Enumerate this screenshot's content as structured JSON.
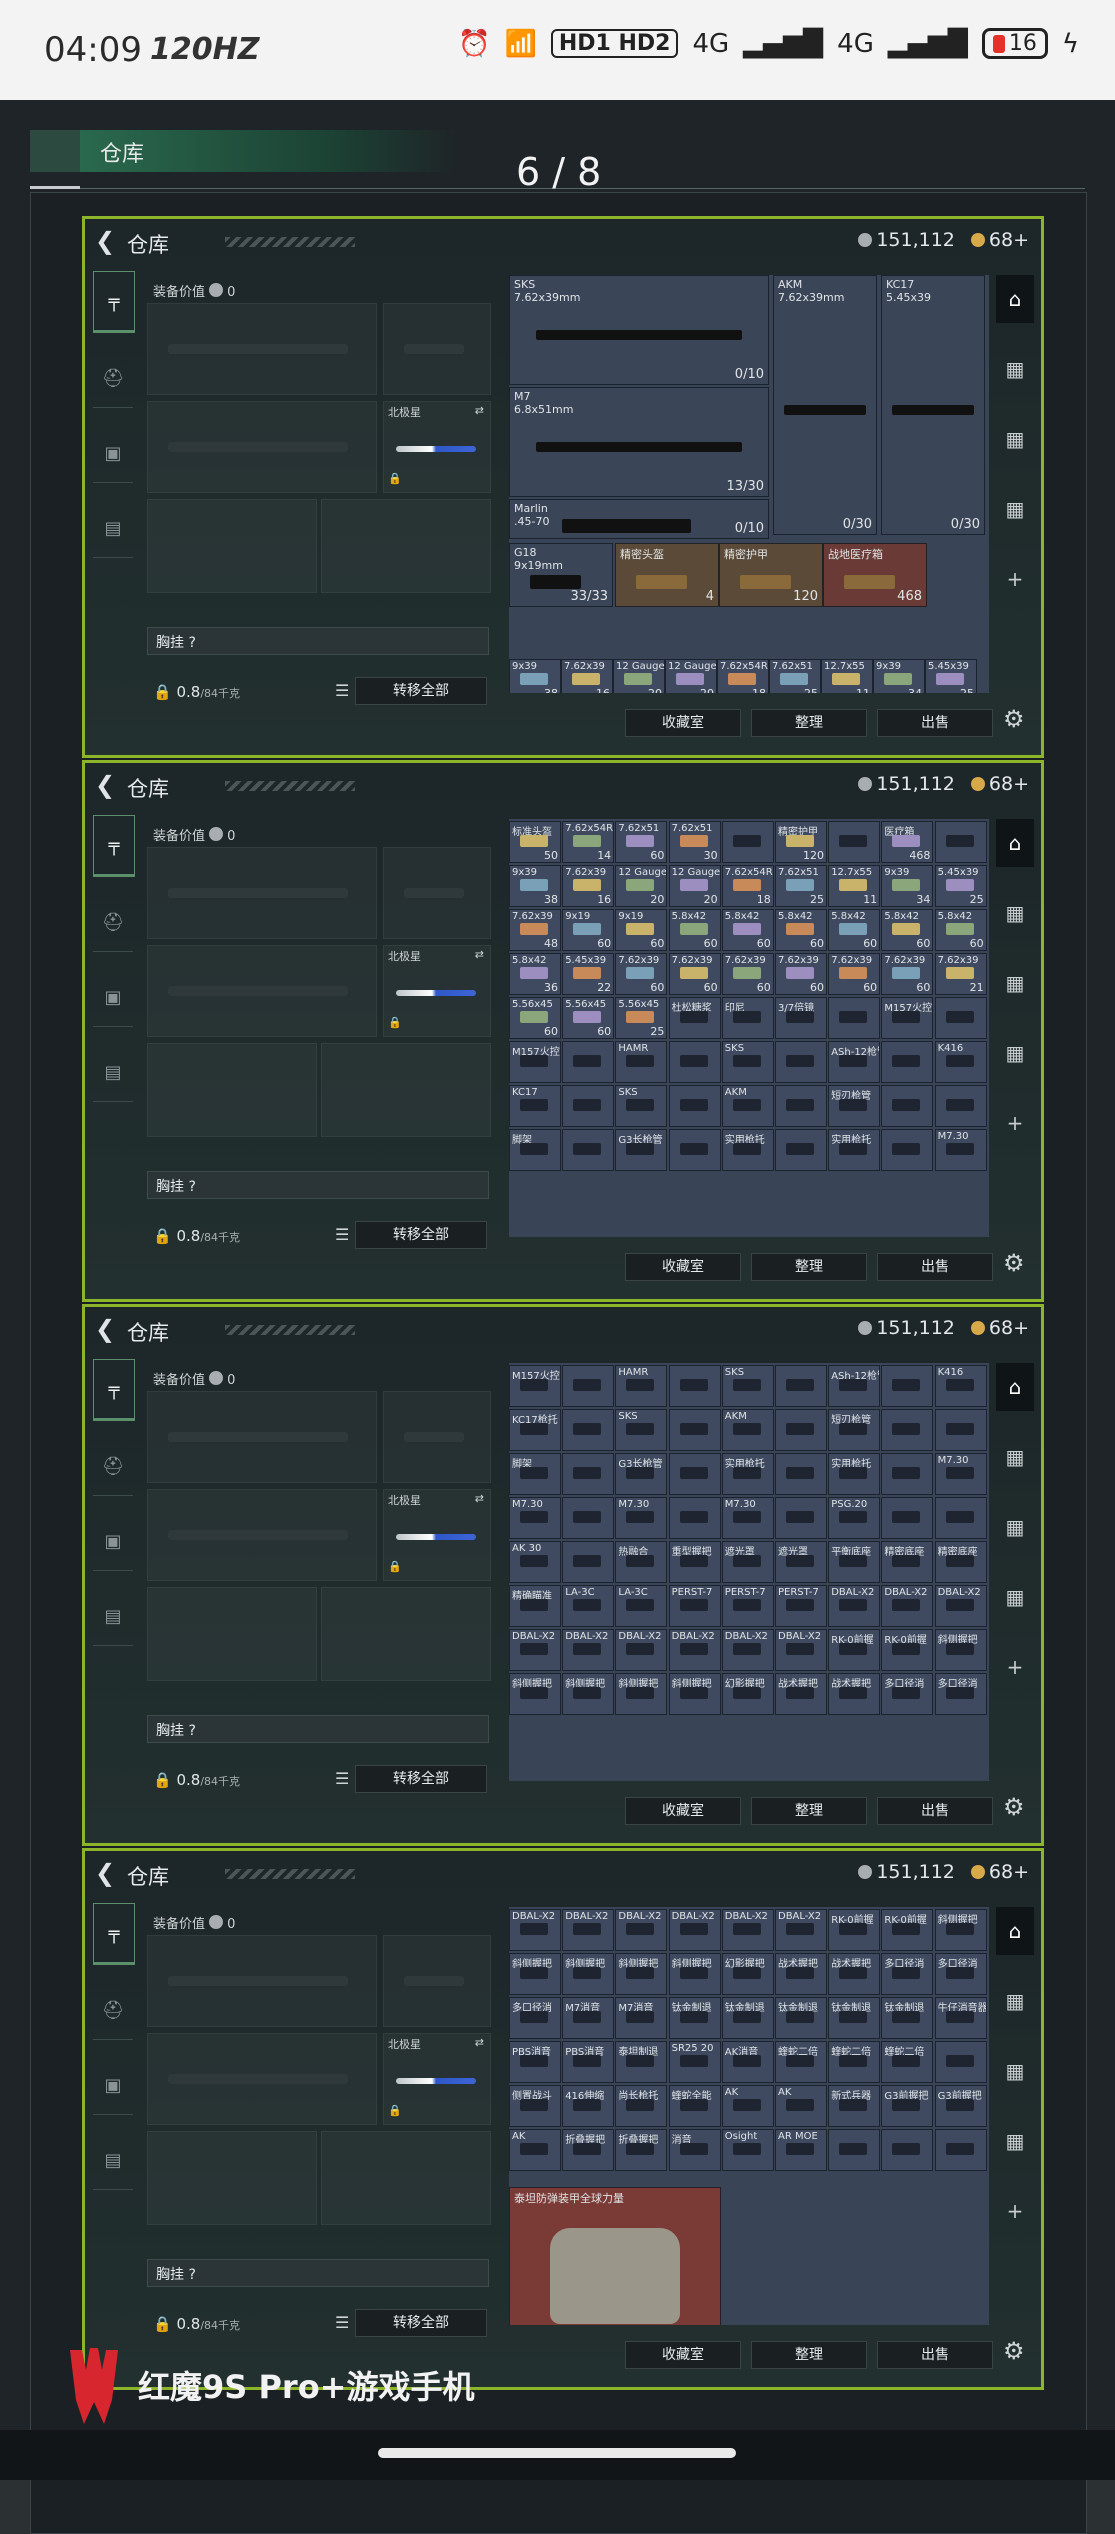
{
  "status": {
    "time": "04:09",
    "hz": "120HZ",
    "hd": "HD1 HD2",
    "net1": "4G",
    "net2": "4G",
    "battery": "16"
  },
  "screen": {
    "top_tab": "仓库",
    "pager": "6 / 8"
  },
  "panel": {
    "title": "仓库",
    "silver": "151,112",
    "gold": "68+",
    "equip_value_label": "装备价值",
    "equip_value": "0",
    "knife_label": "北极星",
    "chest_label": "胸挂 ?",
    "weight": "0.8",
    "weight_max": "/84千克",
    "transfer_all": "转移全部",
    "btn_storage": "收藏室",
    "btn_sort": "整理",
    "btn_sell": "出售"
  },
  "panels": [
    {
      "big": [
        {
          "name": "SKS",
          "cal": "7.62x39mm",
          "qty": "0/10"
        },
        {
          "name": "AKM",
          "cal": "7.62x39mm",
          "qty": "0/30"
        },
        {
          "name": "KC17",
          "cal": "5.45x39",
          "qty": "0/30"
        },
        {
          "name": "M7",
          "cal": "6.8x51mm",
          "qty": "13/30"
        },
        {
          "name": "Marlin",
          "cal": ".45-70",
          "qty": "0/10"
        },
        {
          "name": "G18",
          "cal": "9x19mm",
          "qty": "33/33"
        },
        {
          "name": "精密头盔",
          "cal": "",
          "qty": "4"
        },
        {
          "name": "精密护甲",
          "cal": "",
          "qty": "120"
        },
        {
          "name": "战地医疗箱",
          "cal": "",
          "qty": "468"
        }
      ],
      "cells": [
        [
          "标准头盔",
          "50"
        ],
        [
          "7.62x54R",
          "14"
        ],
        [
          "7.62x51",
          "60"
        ],
        [
          "7.62x51",
          "30"
        ],
        [
          "9x39",
          "38"
        ],
        [
          "7.62x39",
          "16"
        ],
        [
          "12 Gauge",
          "20"
        ],
        [
          "12 Gauge",
          "20"
        ],
        [
          "7.62x54R",
          "18"
        ],
        [
          "7.62x51",
          "25"
        ],
        [
          "12.7x55",
          "11"
        ],
        [
          "9x39",
          "34"
        ],
        [
          "5.45x39",
          "25"
        ]
      ]
    },
    {
      "cells": [
        [
          "标准头盔",
          "50"
        ],
        [
          "7.62x54R",
          "14"
        ],
        [
          "7.62x51",
          "60"
        ],
        [
          "7.62x51",
          "30"
        ],
        [
          "",
          ""
        ],
        [
          "精密护甲",
          "120"
        ],
        [
          "",
          ""
        ],
        [
          "医疗箱",
          "468"
        ],
        [
          "",
          ""
        ],
        [
          "9x39",
          "38"
        ],
        [
          "7.62x39",
          "16"
        ],
        [
          "12 Gauge",
          "20"
        ],
        [
          "12 Gauge",
          "20"
        ],
        [
          "7.62x54R",
          "18"
        ],
        [
          "7.62x51",
          "25"
        ],
        [
          "12.7x55",
          "11"
        ],
        [
          "9x39",
          "34"
        ],
        [
          "5.45x39",
          "25"
        ],
        [
          "7.62x39",
          "48"
        ],
        [
          "9x19",
          "60"
        ],
        [
          "9x19",
          "60"
        ],
        [
          "5.8x42",
          "60"
        ],
        [
          "5.8x42",
          "60"
        ],
        [
          "5.8x42",
          "60"
        ],
        [
          "5.8x42",
          "60"
        ],
        [
          "5.8x42",
          "60"
        ],
        [
          "5.8x42",
          "60"
        ],
        [
          "5.8x42",
          "36"
        ],
        [
          "5.45x39",
          "22"
        ],
        [
          "7.62x39",
          "60"
        ],
        [
          "7.62x39",
          "60"
        ],
        [
          "7.62x39",
          "60"
        ],
        [
          "7.62x39",
          "60"
        ],
        [
          "7.62x39",
          "60"
        ],
        [
          "7.62x39",
          "60"
        ],
        [
          "7.62x39",
          "21"
        ],
        [
          "5.56x45",
          "60"
        ],
        [
          "5.56x45",
          "60"
        ],
        [
          "5.56x45",
          "25"
        ],
        [
          "杜松糖浆",
          ""
        ],
        [
          "印尼",
          ""
        ],
        [
          "3/7倍镜",
          ""
        ],
        [
          "",
          ""
        ],
        [
          "M157火控",
          ""
        ],
        [
          "",
          ""
        ],
        [
          "M157火控",
          ""
        ],
        [
          "",
          ""
        ],
        [
          "HAMR",
          ""
        ],
        [
          "",
          ""
        ],
        [
          "SKS",
          ""
        ],
        [
          "",
          ""
        ],
        [
          "ASh-12枪管",
          ""
        ],
        [
          "",
          ""
        ],
        [
          "K416",
          ""
        ],
        [
          "KC17",
          ""
        ],
        [
          "",
          ""
        ],
        [
          "SKS",
          ""
        ],
        [
          "",
          ""
        ],
        [
          "AKM",
          ""
        ],
        [
          "",
          ""
        ],
        [
          "短刃枪管",
          ""
        ],
        [
          "",
          ""
        ],
        [
          "",
          ""
        ],
        [
          "脚架",
          ""
        ],
        [
          "",
          ""
        ],
        [
          "G3长枪管",
          ""
        ],
        [
          "",
          ""
        ],
        [
          "实用枪托",
          ""
        ],
        [
          "",
          ""
        ],
        [
          "实用枪托",
          ""
        ],
        [
          "",
          ""
        ],
        [
          "M7.30",
          ""
        ]
      ]
    },
    {
      "cells": [
        [
          "M157火控",
          ""
        ],
        [
          "",
          ""
        ],
        [
          "HAMR",
          ""
        ],
        [
          "",
          ""
        ],
        [
          "SKS",
          ""
        ],
        [
          "",
          ""
        ],
        [
          "ASh-12枪管",
          ""
        ],
        [
          "",
          ""
        ],
        [
          "K416",
          ""
        ],
        [
          "KC17枪托",
          ""
        ],
        [
          "",
          ""
        ],
        [
          "SKS",
          ""
        ],
        [
          "",
          ""
        ],
        [
          "AKM",
          ""
        ],
        [
          "",
          ""
        ],
        [
          "短刃枪管",
          ""
        ],
        [
          "",
          ""
        ],
        [
          "",
          ""
        ],
        [
          "脚架",
          ""
        ],
        [
          "",
          ""
        ],
        [
          "G3长枪管",
          ""
        ],
        [
          "",
          ""
        ],
        [
          "实用枪托",
          ""
        ],
        [
          "",
          ""
        ],
        [
          "实用枪托",
          ""
        ],
        [
          "",
          ""
        ],
        [
          "M7.30",
          ""
        ],
        [
          "M7.30",
          ""
        ],
        [
          "",
          ""
        ],
        [
          "M7.30",
          ""
        ],
        [
          "",
          ""
        ],
        [
          "M7.30",
          ""
        ],
        [
          "",
          ""
        ],
        [
          "PSG.20",
          ""
        ],
        [
          "",
          ""
        ],
        [
          "",
          ""
        ],
        [
          "AK 30",
          ""
        ],
        [
          "",
          ""
        ],
        [
          "热融合",
          ""
        ],
        [
          "重型握把",
          ""
        ],
        [
          "遮光罩",
          ""
        ],
        [
          "遮光罩",
          ""
        ],
        [
          "平衡底座",
          ""
        ],
        [
          "精密底座",
          ""
        ],
        [
          "精密底座",
          ""
        ],
        [
          "精确瞄准",
          ""
        ],
        [
          "LA-3C",
          ""
        ],
        [
          "LA-3C",
          ""
        ],
        [
          "PERST-7",
          ""
        ],
        [
          "PERST-7",
          ""
        ],
        [
          "PERST-7",
          ""
        ],
        [
          "DBAL-X2",
          ""
        ],
        [
          "DBAL-X2",
          ""
        ],
        [
          "DBAL-X2",
          ""
        ],
        [
          "DBAL-X2",
          ""
        ],
        [
          "DBAL-X2",
          ""
        ],
        [
          "DBAL-X2",
          ""
        ],
        [
          "DBAL-X2",
          ""
        ],
        [
          "DBAL-X2",
          ""
        ],
        [
          "DBAL-X2",
          ""
        ],
        [
          "RK-0前握",
          ""
        ],
        [
          "RK-0前握",
          ""
        ],
        [
          "斜侧握把",
          ""
        ],
        [
          "斜侧握把",
          ""
        ],
        [
          "斜侧握把",
          ""
        ],
        [
          "斜侧握把",
          ""
        ],
        [
          "斜侧握把",
          ""
        ],
        [
          "幻影握把",
          ""
        ],
        [
          "战术握把",
          ""
        ],
        [
          "战术握把",
          ""
        ],
        [
          "多口径消",
          ""
        ],
        [
          "多口径消",
          ""
        ]
      ]
    },
    {
      "cells": [
        [
          "DBAL-X2",
          ""
        ],
        [
          "DBAL-X2",
          ""
        ],
        [
          "DBAL-X2",
          ""
        ],
        [
          "DBAL-X2",
          ""
        ],
        [
          "DBAL-X2",
          ""
        ],
        [
          "DBAL-X2",
          ""
        ],
        [
          "RK-0前握",
          ""
        ],
        [
          "RK-0前握",
          ""
        ],
        [
          "斜侧握把",
          ""
        ],
        [
          "斜侧握把",
          ""
        ],
        [
          "斜侧握把",
          ""
        ],
        [
          "斜侧握把",
          ""
        ],
        [
          "斜侧握把",
          ""
        ],
        [
          "幻影握把",
          ""
        ],
        [
          "战术握把",
          ""
        ],
        [
          "战术握把",
          ""
        ],
        [
          "多口径消",
          ""
        ],
        [
          "多口径消",
          ""
        ],
        [
          "多口径消",
          ""
        ],
        [
          "M7消音",
          ""
        ],
        [
          "M7消音",
          ""
        ],
        [
          "钛金制退",
          ""
        ],
        [
          "钛金制退",
          ""
        ],
        [
          "钛金制退",
          ""
        ],
        [
          "钛金制退",
          ""
        ],
        [
          "钛金制退",
          ""
        ],
        [
          "牛仔消音器",
          ""
        ],
        [
          "PBS消音",
          ""
        ],
        [
          "PBS消音",
          ""
        ],
        [
          "泰坦制退",
          ""
        ],
        [
          "SR25 20",
          ""
        ],
        [
          "AK消音",
          ""
        ],
        [
          "蝰蛇二倍",
          ""
        ],
        [
          "蝰蛇二倍",
          ""
        ],
        [
          "蝰蛇二倍",
          ""
        ],
        [
          "",
          ""
        ],
        [
          "侧置战斗",
          ""
        ],
        [
          "416伸缩",
          ""
        ],
        [
          "尚长枪托",
          ""
        ],
        [
          "蝰蛇全能",
          ""
        ],
        [
          "AK",
          ""
        ],
        [
          "AK",
          ""
        ],
        [
          "新式兵器",
          ""
        ],
        [
          "G3前握把",
          ""
        ],
        [
          "G3前握把",
          ""
        ],
        [
          "AK",
          ""
        ],
        [
          "折叠握把",
          ""
        ],
        [
          "折叠握把",
          ""
        ],
        [
          "消音",
          ""
        ],
        [
          "Osight",
          ""
        ],
        [
          "AR MOE",
          ""
        ],
        [
          "",
          ""
        ],
        [
          "",
          ""
        ],
        [
          "",
          ""
        ]
      ],
      "armor": "泰坦防弹装甲全球力量"
    }
  ],
  "watermark": "红魔9S Pro+游戏手机",
  "colors": {
    "accent": "#8cb52a",
    "cell": "#3f4a60",
    "gold_cell": "#6b5336",
    "red_cell": "#7a3a36"
  },
  "icons": {
    "back": "‹",
    "gun": "pistol-icon",
    "gear": "⚙"
  }
}
